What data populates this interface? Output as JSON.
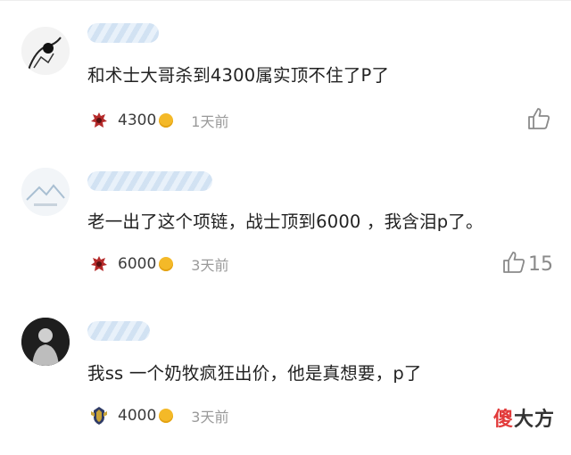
{
  "comments": [
    {
      "text": "和术士大哥杀到4300属实顶不住了P了",
      "faction": "horde-icon",
      "points": "4300",
      "time": "1天前",
      "likes": ""
    },
    {
      "text": "老一出了这个项链，战士顶到6000 ，我含泪p了。",
      "faction": "horde-icon",
      "points": "6000",
      "time": "3天前",
      "likes": "15"
    },
    {
      "text": "我ss 一个奶牧疯狂出价，他是真想要，p了",
      "faction": "alliance-icon",
      "points": "4000",
      "time": "3天前",
      "likes": ""
    }
  ],
  "watermark": {
    "part1": "傻",
    "part2": "大方"
  },
  "colors": {
    "coin": "#f4b928",
    "horde": "#b52a2a",
    "alliance": "#2f3b66",
    "text": "#222222",
    "muted": "#9a9a9a"
  }
}
